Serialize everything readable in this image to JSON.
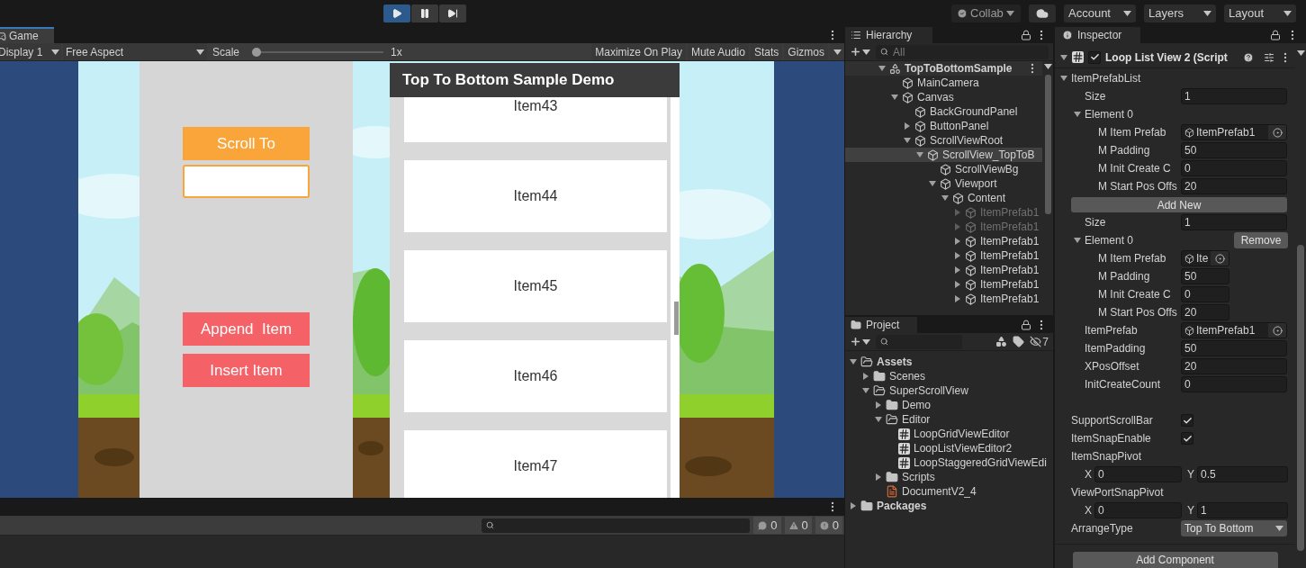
{
  "toolbar": {
    "play_buttons": [
      {
        "kind": "play",
        "on": true
      },
      {
        "kind": "pause",
        "on": false
      },
      {
        "kind": "step",
        "on": false
      }
    ],
    "collab": "Collab",
    "menus": [
      "Account",
      "Layers",
      "Layout"
    ]
  },
  "game": {
    "tab": {
      "label": "Game",
      "selected": true
    },
    "display": "Display 1",
    "aspect": "Free Aspect",
    "scale_label": "Scale",
    "scale": {
      "level": 0,
      "reading": "1x"
    },
    "toggles": [
      "Maximize On Play",
      "Mute Audio",
      "Stats",
      "Gizmos"
    ],
    "scroll_to_button": "Scroll To",
    "action_buttons": [
      "Append  Item",
      "Insert Item"
    ],
    "list": {
      "title": "Top To Bottom Sample Demo",
      "items": [
        "Item43",
        "Item44",
        "Item45",
        "Item46",
        "Item47"
      ]
    }
  },
  "console": {
    "counts": [
      {
        "kind": "log",
        "count": "0"
      },
      {
        "kind": "warning",
        "count": "0"
      },
      {
        "kind": "error",
        "count": "0"
      }
    ]
  },
  "hierarchy": {
    "title": "Hierarchy",
    "search_placeholder": "All",
    "tree": [
      {
        "label": "TopToBottomSample",
        "kind": "scene",
        "expanded": true,
        "selected": false,
        "children": [
          {
            "label": "MainCamera",
            "kind": "object",
            "selected": false
          },
          {
            "label": "Canvas",
            "kind": "object",
            "expanded": true,
            "selected": false,
            "children": [
              {
                "label": "BackGroundPanel",
                "kind": "object",
                "selected": false
              },
              {
                "label": "ButtonPanel",
                "kind": "object",
                "expanded": false,
                "selected": false
              },
              {
                "label": "ScrollViewRoot",
                "kind": "object",
                "expanded": true,
                "selected": false,
                "children": [
                  {
                    "label": "ScrollView_TopToB",
                    "kind": "object",
                    "expanded": true,
                    "selected": true,
                    "children": [
                      {
                        "label": "ScrollViewBg",
                        "kind": "object",
                        "selected": false
                      },
                      {
                        "label": "Viewport",
                        "kind": "object",
                        "expanded": true,
                        "selected": false,
                        "children": [
                          {
                            "label": "Content",
                            "kind": "object",
                            "expanded": true,
                            "selected": false,
                            "children": [
                              {
                                "label": "ItemPrefab1",
                                "kind": "object",
                                "expanded": false,
                                "selected": false,
                                "disabled": true
                              },
                              {
                                "label": "ItemPrefab1",
                                "kind": "object",
                                "expanded": false,
                                "selected": false,
                                "disabled": true
                              },
                              {
                                "label": "ItemPrefab1",
                                "kind": "object",
                                "expanded": false,
                                "selected": false,
                                "disabled": false
                              },
                              {
                                "label": "ItemPrefab1",
                                "kind": "object",
                                "expanded": false,
                                "selected": false,
                                "disabled": false
                              },
                              {
                                "label": "ItemPrefab1",
                                "kind": "object",
                                "expanded": false,
                                "selected": false,
                                "disabled": false
                              },
                              {
                                "label": "ItemPrefab1",
                                "kind": "object",
                                "expanded": false,
                                "selected": false,
                                "disabled": false
                              },
                              {
                                "label": "ItemPrefab1",
                                "kind": "object",
                                "expanded": false,
                                "selected": false,
                                "disabled": false
                              }
                            ]
                          }
                        ]
                      }
                    ]
                  }
                ]
              }
            ]
          }
        ]
      }
    ]
  },
  "project": {
    "title": "Project",
    "hidden_count": "7",
    "tree": [
      {
        "label": "Assets",
        "kind": "folder",
        "expanded": true,
        "children": [
          {
            "label": "Scenes",
            "kind": "folder",
            "expanded": false
          },
          {
            "label": "SuperScrollView",
            "kind": "folder",
            "expanded": true,
            "children": [
              {
                "label": "Demo",
                "kind": "folder",
                "expanded": false
              },
              {
                "label": "Editor",
                "kind": "folder",
                "expanded": true,
                "children": [
                  {
                    "label": "LoopGridViewEditor",
                    "kind": "script"
                  },
                  {
                    "label": "LoopListViewEditor2",
                    "kind": "script"
                  },
                  {
                    "label": "LoopStaggeredGridViewEdi",
                    "kind": "script"
                  }
                ]
              },
              {
                "label": "Scripts",
                "kind": "folder",
                "expanded": false
              },
              {
                "label": "DocumentV2_4",
                "kind": "document"
              }
            ]
          }
        ]
      },
      {
        "label": "Packages",
        "kind": "folder",
        "expanded": false
      }
    ]
  },
  "inspector": {
    "title": "Inspector",
    "component": {
      "title": "Loop List View 2 (Script",
      "enabled": true,
      "expanded": true
    },
    "rows": [
      {
        "kind": "foldout",
        "label": "ItemPrefabList",
        "expanded": true,
        "children": [
          {
            "kind": "field",
            "label": "Size",
            "value": "1"
          },
          {
            "kind": "foldout",
            "label": "Element 0",
            "expanded": true,
            "children": [
              {
                "kind": "object",
                "label": "M Item Prefab",
                "value": "ItemPrefab1"
              },
              {
                "kind": "field",
                "label": "M Padding",
                "value": "50"
              },
              {
                "kind": "field",
                "label": "M Init Create C",
                "value": "0"
              },
              {
                "kind": "field",
                "label": "M Start Pos Offs",
                "value": "20"
              }
            ]
          },
          {
            "kind": "button",
            "label": "Add New"
          },
          {
            "kind": "field",
            "label": "Size",
            "value": "1"
          },
          {
            "kind": "foldout",
            "label": "Element 0",
            "expanded": true,
            "button": "Remove",
            "children": [
              {
                "kind": "object",
                "label": "M Item Prefab",
                "value": "Ite"
              },
              {
                "kind": "field",
                "label": "M Padding",
                "value": "50"
              },
              {
                "kind": "field",
                "label": "M Init Create C",
                "value": "0"
              },
              {
                "kind": "field",
                "label": "M Start Pos Offs",
                "value": "20"
              }
            ]
          },
          {
            "kind": "object",
            "label": "ItemPrefab",
            "value": "ItemPrefab1"
          },
          {
            "kind": "field",
            "label": "ItemPadding",
            "value": "50"
          },
          {
            "kind": "field",
            "label": "XPosOffset",
            "value": "20"
          },
          {
            "kind": "field",
            "label": "InitCreateCount",
            "value": "0"
          }
        ]
      },
      {
        "kind": "checkbox",
        "label": "SupportScrollBar",
        "checked": true
      },
      {
        "kind": "checkbox",
        "label": "ItemSnapEnable",
        "checked": true
      },
      {
        "kind": "vector2",
        "label": "ItemSnapPivot",
        "fields": [
          {
            "axis": "X",
            "value": "0"
          },
          {
            "axis": "Y",
            "value": "0.5"
          }
        ]
      },
      {
        "kind": "vector2",
        "label": "ViewPortSnapPivot",
        "fields": [
          {
            "axis": "X",
            "value": "0"
          },
          {
            "axis": "Y",
            "value": "1"
          }
        ]
      },
      {
        "kind": "dropdown",
        "label": "ArrangeType",
        "value": "Top To Bottom"
      }
    ],
    "add_component": "Add Component"
  }
}
